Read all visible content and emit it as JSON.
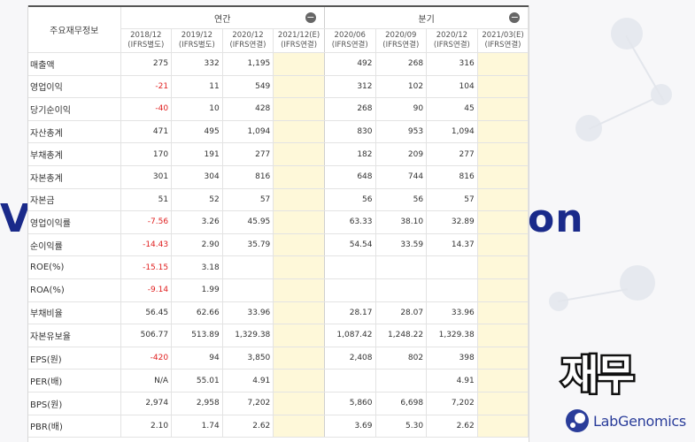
{
  "table": {
    "corner_label": "주요재무정보",
    "groups": [
      {
        "name": "연간",
        "collapse_icon": "minus-circle-icon"
      },
      {
        "name": "분기",
        "collapse_icon": "minus-circle-icon"
      }
    ],
    "periods": [
      {
        "date": "2018/12",
        "basis": "(IFRS별도)"
      },
      {
        "date": "2019/12",
        "basis": "(IFRS별도)"
      },
      {
        "date": "2020/12",
        "basis": "(IFRS연결)"
      },
      {
        "date": "2021/12(E)",
        "basis": "(IFRS연결)"
      },
      {
        "date": "2020/06",
        "basis": "(IFRS연결)"
      },
      {
        "date": "2020/09",
        "basis": "(IFRS연결)"
      },
      {
        "date": "2020/12",
        "basis": "(IFRS연결)"
      },
      {
        "date": "2021/03(E)",
        "basis": "(IFRS연결)"
      }
    ],
    "rows": [
      {
        "label": "매출액",
        "values": [
          "275",
          "332",
          "1,195",
          "",
          "492",
          "268",
          "316",
          ""
        ]
      },
      {
        "label": "영업이익",
        "values": [
          "-21",
          "11",
          "549",
          "",
          "312",
          "102",
          "104",
          ""
        ]
      },
      {
        "label": "당기순이익",
        "values": [
          "-40",
          "10",
          "428",
          "",
          "268",
          "90",
          "45",
          ""
        ]
      },
      {
        "label": "자산총계",
        "values": [
          "471",
          "495",
          "1,094",
          "",
          "830",
          "953",
          "1,094",
          ""
        ]
      },
      {
        "label": "부채총계",
        "values": [
          "170",
          "191",
          "277",
          "",
          "182",
          "209",
          "277",
          ""
        ]
      },
      {
        "label": "자본총계",
        "values": [
          "301",
          "304",
          "816",
          "",
          "648",
          "744",
          "816",
          ""
        ]
      },
      {
        "label": "자본금",
        "values": [
          "51",
          "52",
          "57",
          "",
          "56",
          "56",
          "57",
          ""
        ]
      },
      {
        "label": "영업이익률",
        "values": [
          "-7.56",
          "3.26",
          "45.95",
          "",
          "63.33",
          "38.10",
          "32.89",
          ""
        ]
      },
      {
        "label": "순이익률",
        "values": [
          "-14.43",
          "2.90",
          "35.79",
          "",
          "54.54",
          "33.59",
          "14.37",
          ""
        ]
      },
      {
        "label": "ROE(%)",
        "values": [
          "-15.15",
          "3.18",
          "",
          "",
          "",
          "",
          "",
          ""
        ]
      },
      {
        "label": "ROA(%)",
        "values": [
          "-9.14",
          "1.99",
          "",
          "",
          "",
          "",
          "",
          ""
        ]
      },
      {
        "label": "부채비율",
        "values": [
          "56.45",
          "62.66",
          "33.96",
          "",
          "28.17",
          "28.07",
          "33.96",
          ""
        ]
      },
      {
        "label": "자본유보율",
        "values": [
          "506.77",
          "513.89",
          "1,329.38",
          "",
          "1,087.42",
          "1,248.22",
          "1,329.38",
          ""
        ]
      },
      {
        "label": "EPS(원)",
        "values": [
          "-420",
          "94",
          "3,850",
          "",
          "2,408",
          "802",
          "398",
          ""
        ]
      },
      {
        "label": "PER(배)",
        "values": [
          "N/A",
          "55.01",
          "4.91",
          "",
          "",
          "",
          "4.91",
          ""
        ]
      },
      {
        "label": "BPS(원)",
        "values": [
          "2,974",
          "2,958",
          "7,202",
          "",
          "5,860",
          "6,698",
          "7,202",
          ""
        ]
      },
      {
        "label": "PBR(배)",
        "values": [
          "2.10",
          "1.74",
          "2.62",
          "",
          "3.69",
          "5.30",
          "2.62",
          ""
        ]
      }
    ]
  },
  "overlay": {
    "badge_text": "재무",
    "logo_text": "LabGenomics",
    "logo_icon": "labgenomics-logo-icon",
    "bg_text_left": "V",
    "bg_text_right": "on"
  },
  "colors": {
    "negative": "#e02020",
    "estimate_fill": "#fef8d9",
    "brand": "#2a3d9a"
  }
}
